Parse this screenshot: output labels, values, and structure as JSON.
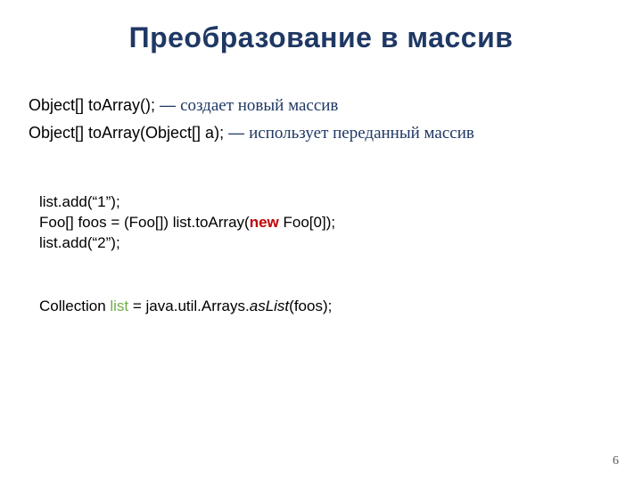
{
  "title": "Преобразование в массив",
  "signatures": [
    {
      "code": "Object[] toArray();",
      "dash": "—",
      "desc": "создает новый массив"
    },
    {
      "code": "Object[] toArray(Object[] a);",
      "dash": "—",
      "desc": "использует переданный массив"
    }
  ],
  "code1": {
    "line1": "list.add(“1”);",
    "line2_pre": "Foo[] foos = (Foo[]) list.toArray(",
    "line2_kw": "new",
    "line2_post": " Foo[0]);",
    "line3": "list.add(“2”);"
  },
  "code2": {
    "pre": "Collection ",
    "var": "list",
    "mid": " = java.util.Arrays.",
    "method": "asList",
    "post": "(foos);"
  },
  "page_number": "6"
}
